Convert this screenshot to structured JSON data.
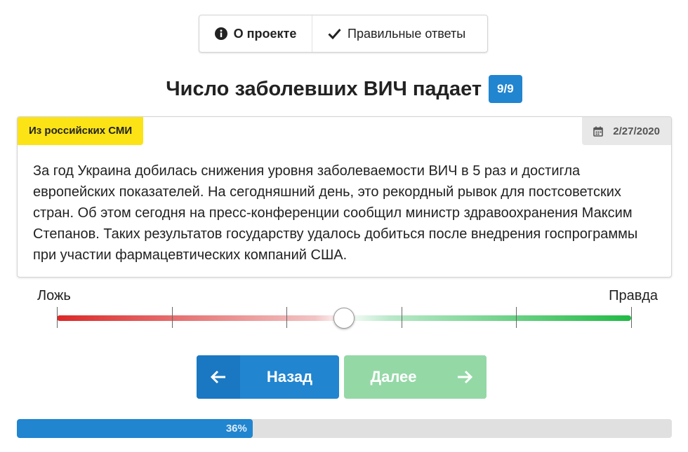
{
  "menu": {
    "about_label": "О проекте",
    "answers_label": "Правильные ответы"
  },
  "header": {
    "title": "Число заболевших ВИЧ падает",
    "counter": "9/9"
  },
  "card": {
    "source": "Из российских СМИ",
    "date": "2/27/2020",
    "text": "За год Украина добилась снижения уровня заболеваемости ВИЧ в 5 раз и достигла европейских показателей. На сегодняшний день, это рекордный рывок для постсоветских стран. Об этом сегодня на пресс-конференции сообщил министр здравоохранения Максим Степанов. Таких результатов государству удалось добиться после внедрения госпрограммы при участии фармацевтических компаний США."
  },
  "slider": {
    "label_false": "Ложь",
    "label_true": "Правда",
    "value": 0.5,
    "steps": 5
  },
  "nav": {
    "back_label": "Назад",
    "next_label": "Далее"
  },
  "progress": {
    "value": 0.36,
    "label": "36%"
  },
  "colors": {
    "primary": "#2185d0",
    "next_disabled": "#94d8a6",
    "source_label": "#fbe316",
    "false_end": "#db2828",
    "true_end": "#21ba45"
  },
  "icons": {
    "about": "info-circle-icon",
    "answers": "check-icon",
    "date": "calendar-icon",
    "back": "arrow-left-icon",
    "next": "arrow-right-icon"
  }
}
